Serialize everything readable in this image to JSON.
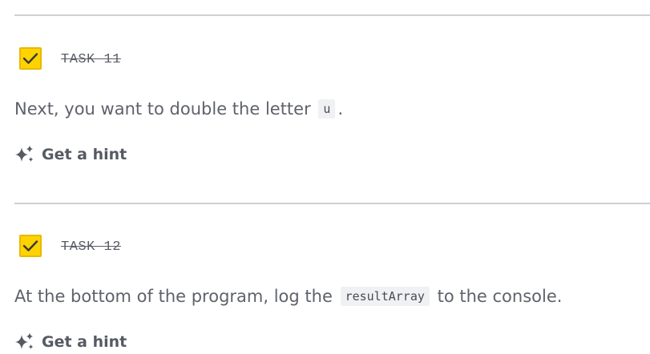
{
  "tasks": [
    {
      "label": "TASK 11",
      "completed": true,
      "text_before": "Next, you want to double the letter",
      "code": "u",
      "text_after": ".",
      "hint_label": "Get a hint"
    },
    {
      "label": "TASK 12",
      "completed": true,
      "text_before": "At the bottom of the program, log the",
      "code": "resultArray",
      "text_after": "to the console.",
      "hint_label": "Get a hint"
    }
  ],
  "colors": {
    "checkbox": "#ffd300",
    "text": "#5f626b",
    "divider": "#cfd0d4"
  },
  "icons": {
    "checkbox": "checkmark-icon",
    "hint": "sparkle-icon"
  }
}
